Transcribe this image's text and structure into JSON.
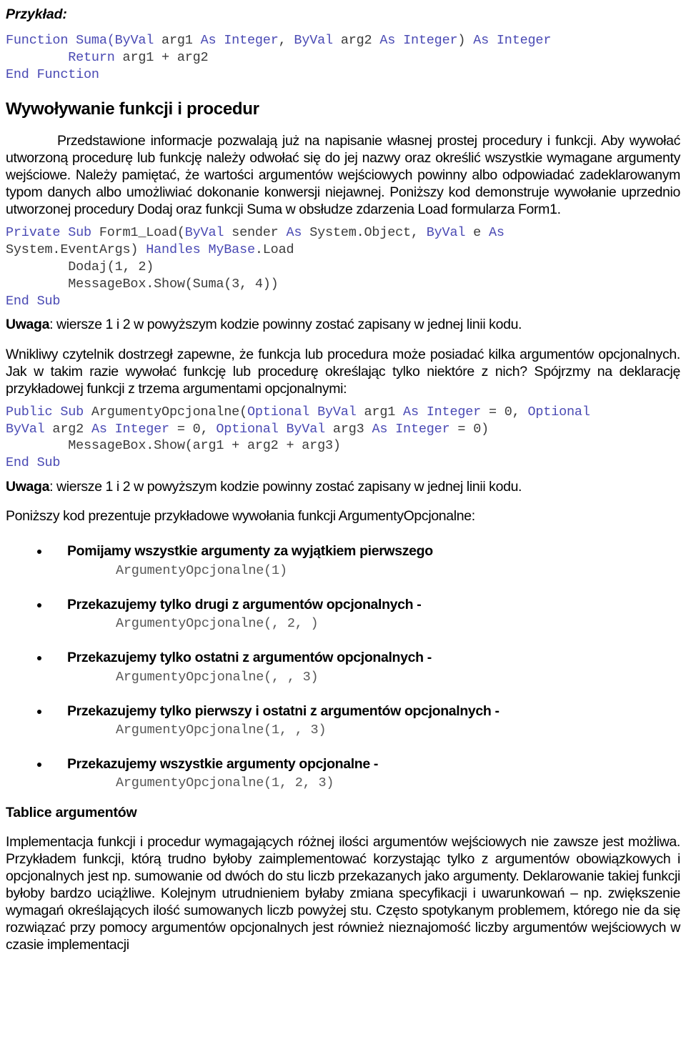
{
  "document": {
    "lead_label": "Przykład:",
    "colors": {
      "keyword": "#4a4ab4",
      "identifier": "#3a3a3a",
      "text": "#000000",
      "code_muted": "#565656",
      "background": "#ffffff"
    }
  },
  "code_blocks": {
    "suma_function": {
      "lines": [
        [
          {
            "t": "Function Suma(",
            "k": true
          },
          {
            "t": "ByVal",
            "k": true
          },
          {
            "t": " arg1 ",
            "k": false
          },
          {
            "t": "As Integer",
            "k": true
          },
          {
            "t": ", ",
            "k": false
          },
          {
            "t": "ByVal",
            "k": true
          },
          {
            "t": " arg2 ",
            "k": false
          },
          {
            "t": "As Integer",
            "k": true
          },
          {
            "t": ") ",
            "k": false
          },
          {
            "t": "As Integer",
            "k": true
          }
        ],
        [
          {
            "t": "        ",
            "k": false
          },
          {
            "t": "Return",
            "k": true
          },
          {
            "t": " arg1 + arg2",
            "k": false
          }
        ],
        [
          {
            "t": "End Function",
            "k": true
          }
        ]
      ],
      "plain": "Function Suma(ByVal arg1 As Integer, ByVal arg2 As Integer) As Integer\n        Return arg1 + arg2\nEnd Function"
    },
    "form1_load": {
      "lines": [
        [
          {
            "t": "Private Sub",
            "k": true
          },
          {
            "t": " Form1_Load(",
            "k": false
          },
          {
            "t": "ByVal",
            "k": true
          },
          {
            "t": " sender ",
            "k": false
          },
          {
            "t": "As",
            "k": true
          },
          {
            "t": " System.Object, ",
            "k": false
          },
          {
            "t": "ByVal",
            "k": true
          },
          {
            "t": " e ",
            "k": false
          },
          {
            "t": "As",
            "k": true
          }
        ],
        [
          {
            "t": "System.EventArgs) ",
            "k": false
          },
          {
            "t": "Handles MyBase",
            "k": true
          },
          {
            "t": ".Load",
            "k": false
          }
        ],
        [
          {
            "t": "        Dodaj(1, 2)",
            "k": false
          }
        ],
        [
          {
            "t": "        MessageBox.Show(Suma(3, 4))",
            "k": false
          }
        ],
        [
          {
            "t": "End Sub",
            "k": true
          }
        ]
      ],
      "plain": "Private Sub Form1_Load(ByVal sender As System.Object, ByVal e As\nSystem.EventArgs) Handles MyBase.Load\n        Dodaj(1, 2)\n        MessageBox.Show(Suma(3, 4))\nEnd Sub"
    },
    "argumenty_opcjonalne": {
      "lines": [
        [
          {
            "t": "Public Sub",
            "k": true
          },
          {
            "t": " ArgumentyOpcjonalne(",
            "k": false
          },
          {
            "t": "Optional ByVal",
            "k": true
          },
          {
            "t": " arg1 ",
            "k": false
          },
          {
            "t": "As Integer",
            "k": true
          },
          {
            "t": " = 0, ",
            "k": false
          },
          {
            "t": "Optional",
            "k": true
          }
        ],
        [
          {
            "t": "ByVal",
            "k": true
          },
          {
            "t": " arg2 ",
            "k": false
          },
          {
            "t": "As Integer",
            "k": true
          },
          {
            "t": " = 0, ",
            "k": false
          },
          {
            "t": "Optional ByVal",
            "k": true
          },
          {
            "t": " arg3 ",
            "k": false
          },
          {
            "t": "As Integer",
            "k": true
          },
          {
            "t": " = 0)",
            "k": false
          }
        ],
        [
          {
            "t": "        MessageBox.Show(arg1 + arg2 + arg3)",
            "k": false
          }
        ],
        [
          {
            "t": "End Sub",
            "k": true
          }
        ]
      ],
      "plain": "Public Sub ArgumentyOpcjonalne(Optional ByVal arg1 As Integer = 0, Optional\nByVal arg2 As Integer = 0, Optional ByVal arg3 As Integer = 0)\n        MessageBox.Show(arg1 + arg2 + arg3)\nEnd Sub"
    }
  },
  "sections": {
    "wywolywanie": {
      "heading": "Wywoływanie funkcji i procedur",
      "paragraph_1": "Przedstawione informacje pozwalają już na napisanie własnej prostej procedury i funkcji. Aby wywołać utworzoną procedurę lub funkcję należy odwołać się do jej nazwy oraz określić wszystkie wymagane argumenty wejściowe. Należy pamiętać, że wartości argumentów wejściowych powinny albo odpowiadać zadeklarowanym typom danych albo umożliwiać dokonanie konwersji niejawnej. Poniższy kod demonstruje wywołanie uprzednio utworzonej procedury Dodaj oraz funkcji Suma w obsłudze zdarzenia Load formularza Form1."
    },
    "uwaga_1": {
      "bold": "Uwaga",
      "rest": ": wiersze 1 i 2 w powyższym kodzie powinny zostać zapisany w jednej linii kodu."
    },
    "paragraph_optional": "Wnikliwy czytelnik dostrzegł zapewne, że funkcja lub procedura może posiadać kilka argumentów opcjonalnych. Jak w takim razie wywołać funkcję lub procedurę określając tylko niektóre z nich? Spójrzmy na deklarację przykładowej funkcji z trzema argumentami opcjonalnymi:",
    "uwaga_2": {
      "bold": "Uwaga",
      "rest": ": wiersze 1 i 2 w powyższym kodzie powinny zostać zapisany w jednej linii kodu."
    },
    "intro_examples": "Poniższy kod prezentuje przykładowe wywołania funkcji ArgumentyOpcjonalne:",
    "tablice": {
      "heading": "Tablice argumentów",
      "paragraph": "Implementacja funkcji i procedur wymagających różnej ilości argumentów wejściowych nie zawsze jest możliwa. Przykładem funkcji, którą trudno byłoby zaimplementować korzystając tylko z argumentów obowiązkowych i opcjonalnych jest np. sumowanie od dwóch do stu liczb przekazanych jako argumenty. Deklarowanie takiej funkcji byłoby bardzo uciążliwe. Kolejnym utrudnieniem byłaby zmiana specyfikacji i uwarunkowań – np. zwiększenie wymagań określających ilość sumowanych liczb powyżej stu. Często spotykanym problemem, którego nie da się rozwiązać przy pomocy argumentów opcjonalnych jest również nieznajomość liczby argumentów wejściowych w czasie implementacji"
    }
  },
  "bullets": [
    {
      "label": "Pomijamy wszystkie argumenty za wyjątkiem pierwszego",
      "code": "ArgumentyOpcjonalne(1)"
    },
    {
      "label": "Przekazujemy tylko drugi z argumentów opcjonalnych -",
      "code": "ArgumentyOpcjonalne(, 2, )"
    },
    {
      "label": "Przekazujemy tylko ostatni z argumentów opcjonalnych -",
      "code": "ArgumentyOpcjonalne(, , 3)"
    },
    {
      "label": "Przekazujemy tylko pierwszy i ostatni z argumentów opcjonalnych -",
      "code": "ArgumentyOpcjonalne(1, , 3)"
    },
    {
      "label": "Przekazujemy wszystkie argumenty opcjonalne -",
      "code": "ArgumentyOpcjonalne(1, 2, 3)"
    }
  ]
}
